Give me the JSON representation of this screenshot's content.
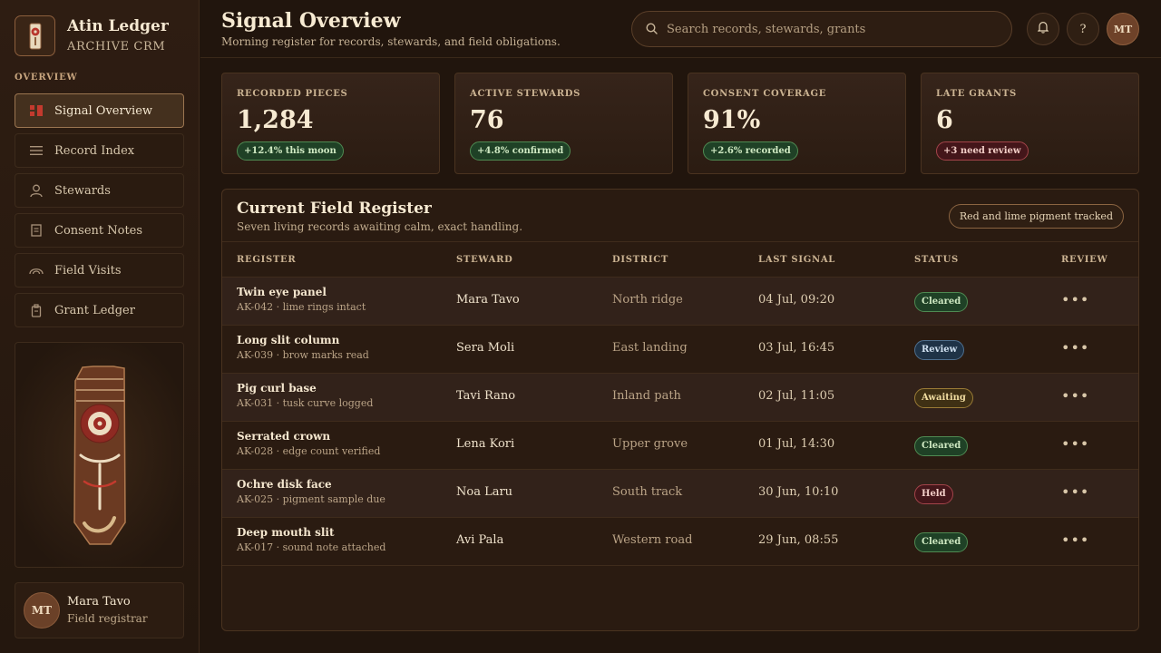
{
  "brand": {
    "title": "Atin Ledger",
    "subtitle": "ARCHIVE CRM"
  },
  "nav": {
    "section": "OVERVIEW",
    "items": [
      {
        "label": "Signal Overview",
        "icon": "overview-icon",
        "active": true
      },
      {
        "label": "Record Index",
        "icon": "list-icon"
      },
      {
        "label": "Stewards",
        "icon": "user-icon"
      },
      {
        "label": "Consent Notes",
        "icon": "document-icon"
      },
      {
        "label": "Field Visits",
        "icon": "arch-icon"
      },
      {
        "label": "Grant Ledger",
        "icon": "ledger-icon"
      }
    ]
  },
  "user": {
    "initials": "MT",
    "name": "Mara Tavo",
    "role": "Field registrar"
  },
  "header": {
    "title": "Signal Overview",
    "subtitle": "Morning register for records, stewards, and field obligations.",
    "search_placeholder": "Search records, stewards, grants",
    "help": "?",
    "avatar": "MT"
  },
  "stats": [
    {
      "label": "RECORDED PIECES",
      "value": "1,284",
      "badge": "+12.4% this moon",
      "tone": "green"
    },
    {
      "label": "ACTIVE STEWARDS",
      "value": "76",
      "badge": "+4.8% confirmed",
      "tone": "green"
    },
    {
      "label": "CONSENT COVERAGE",
      "value": "91%",
      "badge": "+2.6% recorded",
      "tone": "green"
    },
    {
      "label": "LATE GRANTS",
      "value": "6",
      "badge": "+3 need review",
      "tone": "red"
    }
  ],
  "register": {
    "title": "Current Field Register",
    "subtitle": "Seven living records awaiting calm, exact handling.",
    "tag": "Red and lime pigment tracked",
    "columns": [
      "REGISTER",
      "STEWARD",
      "DISTRICT",
      "LAST SIGNAL",
      "STATUS",
      "REVIEW"
    ],
    "rows": [
      {
        "name": "Twin eye panel",
        "meta": "AK-042 · lime rings intact",
        "steward": "Mara Tavo",
        "district": "North ridge",
        "signal": "04 Jul, 09:20",
        "status": "Cleared",
        "status_type": "cleared",
        "review": "•••"
      },
      {
        "name": "Long slit column",
        "meta": "AK-039 · brow marks read",
        "steward": "Sera Moli",
        "district": "East landing",
        "signal": "03 Jul, 16:45",
        "status": "Review",
        "status_type": "review",
        "review": "•••"
      },
      {
        "name": "Pig curl base",
        "meta": "AK-031 · tusk curve logged",
        "steward": "Tavi Rano",
        "district": "Inland path",
        "signal": "02 Jul, 11:05",
        "status": "Awaiting",
        "status_type": "awaiting",
        "review": "•••"
      },
      {
        "name": "Serrated crown",
        "meta": "AK-028 · edge count verified",
        "steward": "Lena Kori",
        "district": "Upper grove",
        "signal": "01 Jul, 14:30",
        "status": "Cleared",
        "status_type": "cleared",
        "review": "•••"
      },
      {
        "name": "Ochre disk face",
        "meta": "AK-025 · pigment sample due",
        "steward": "Noa Laru",
        "district": "South track",
        "signal": "30 Jun, 10:10",
        "status": "Held",
        "status_type": "held",
        "review": "•••"
      },
      {
        "name": "Deep mouth slit",
        "meta": "AK-017 · sound note attached",
        "steward": "Avi Pala",
        "district": "Western road",
        "signal": "29 Jun, 08:55",
        "status": "Cleared",
        "status_type": "cleared",
        "review": "•••"
      }
    ]
  },
  "colors": {
    "accent_red": "#b8362c",
    "lime": "#c9d49a",
    "cleared": "#4f8a52",
    "held": "#a3444a"
  }
}
